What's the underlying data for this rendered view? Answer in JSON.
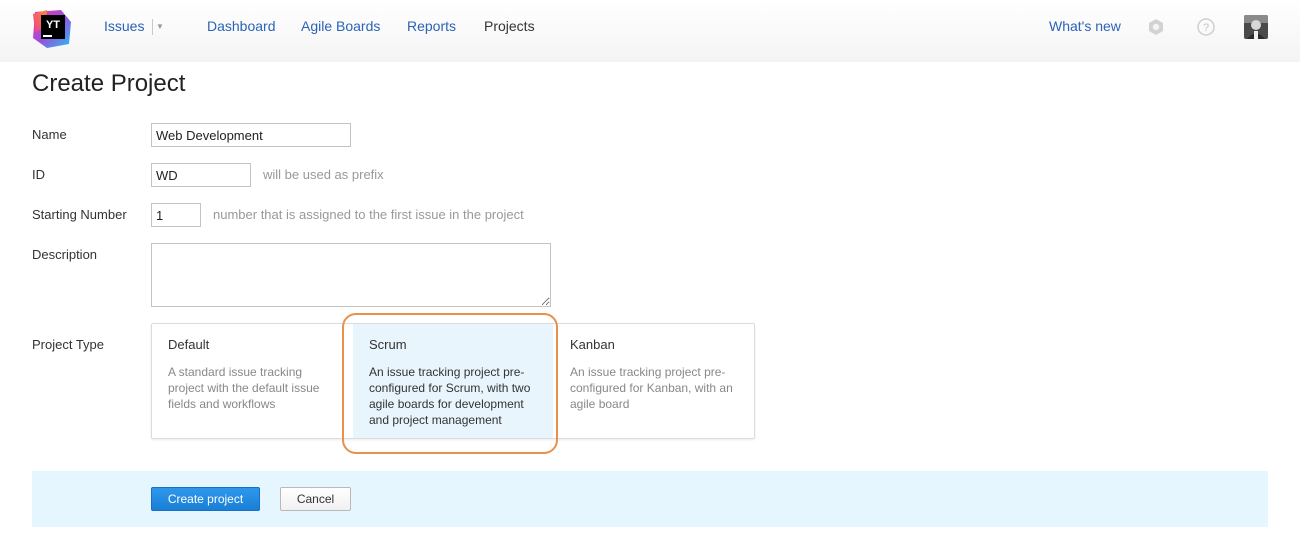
{
  "app": {
    "logo_text": "YT",
    "icons": {
      "logo": "youtrack-logo-icon",
      "settings": "gear-icon",
      "help": "help-icon",
      "avatar": "user-avatar"
    }
  },
  "header": {
    "nav": [
      {
        "label": "Issues",
        "active": false
      },
      {
        "label": "Dashboard",
        "active": false
      },
      {
        "label": "Agile Boards",
        "active": false
      },
      {
        "label": "Reports",
        "active": false
      },
      {
        "label": "Projects",
        "active": true
      }
    ],
    "whats_new": "What's new"
  },
  "page": {
    "title": "Create Project"
  },
  "form": {
    "name": {
      "label": "Name",
      "value": "Web Development"
    },
    "id": {
      "label": "ID",
      "value": "WD",
      "hint": "will be used as prefix"
    },
    "starting_number": {
      "label": "Starting Number",
      "value": "1",
      "hint": "number that is assigned to the first issue in the project"
    },
    "description": {
      "label": "Description",
      "value": ""
    },
    "project_type": {
      "label": "Project Type",
      "selected": "Scrum",
      "options": [
        {
          "title": "Default",
          "description": "A standard issue tracking project with the default issue fields and workflows"
        },
        {
          "title": "Scrum",
          "description": "An issue tracking project pre-configured for Scrum, with two agile boards for development and project management"
        },
        {
          "title": "Kanban",
          "description": "An issue tracking project pre-configured for Kanban, with an agile board"
        }
      ]
    }
  },
  "actions": {
    "create_label": "Create project",
    "cancel_label": "Cancel"
  },
  "colors": {
    "link": "#2b63b6",
    "primary_button": "#1a7fd6",
    "selected_card": "#e8f5fd",
    "footer_bar": "#e6f6fe",
    "highlight_ring": "#e8914a"
  }
}
